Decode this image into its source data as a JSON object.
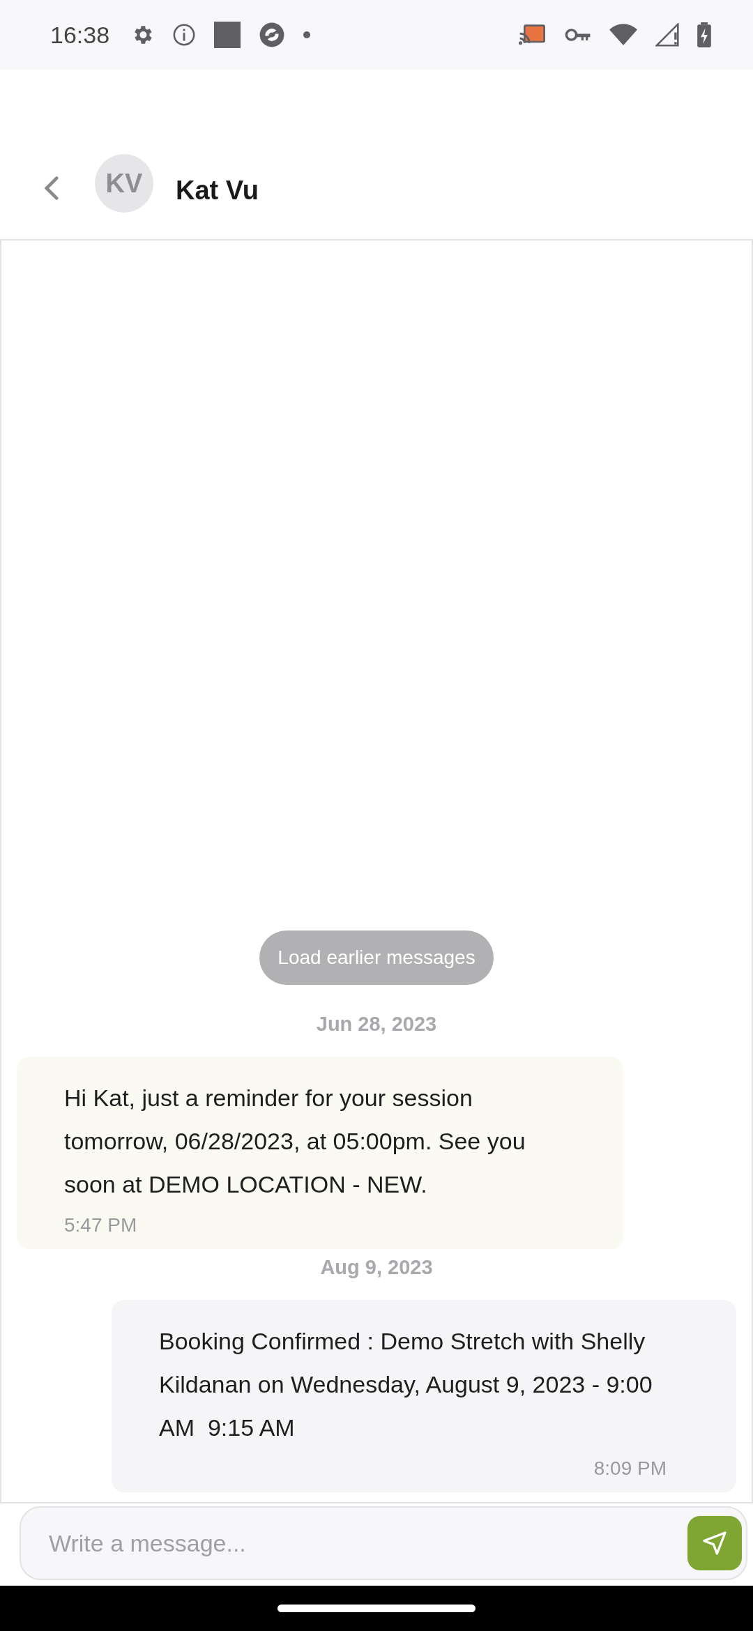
{
  "status_bar": {
    "time": "16:38"
  },
  "header": {
    "avatar_initials": "KV",
    "name": "Kat Vu"
  },
  "load_earlier": {
    "label": "Load earlier messages"
  },
  "messages": [
    {
      "date": "Jun 28, 2023",
      "kind": "incoming",
      "text": "Hi Kat, just a reminder for your session tomorrow, 06/28/2023, at 05:00pm. See you soon at DEMO LOCATION - NEW.",
      "time": "5:47 PM"
    },
    {
      "date": "Aug 9, 2023",
      "kind": "outgoing",
      "text": "Booking Confirmed : Demo Stretch with Shelly Kildanan on Wednesday, August 9, 2023 - 9:00 AM  9:15 AM",
      "time": "8:09 PM"
    }
  ],
  "composer": {
    "placeholder": "Write a message..."
  }
}
